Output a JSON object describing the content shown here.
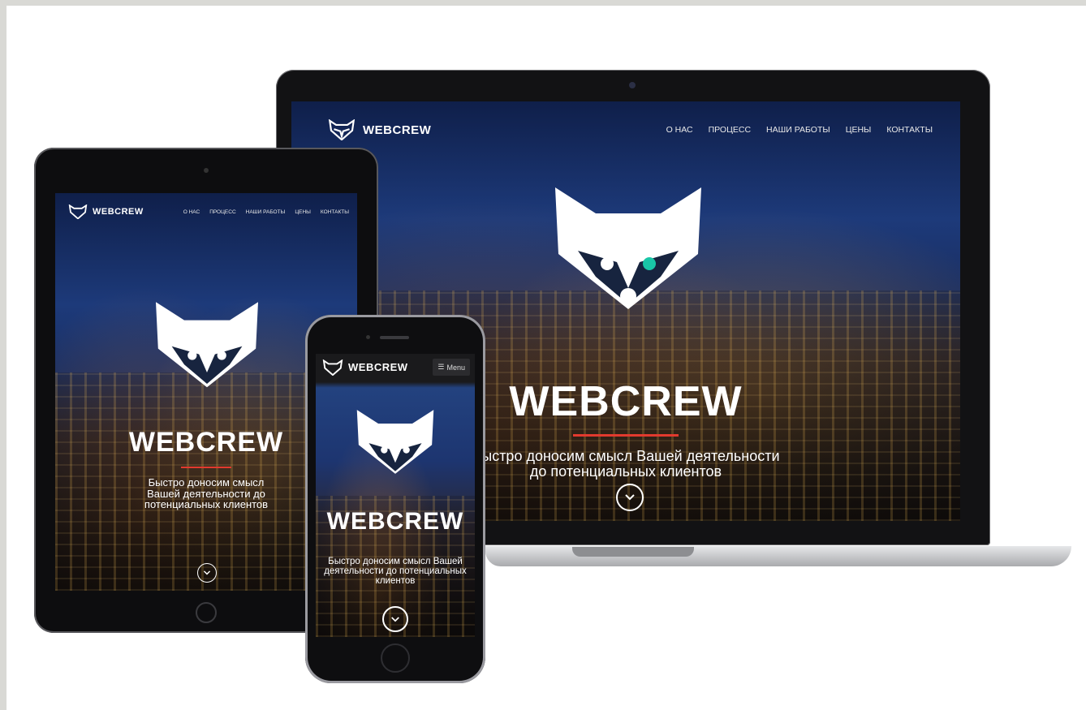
{
  "brand": {
    "name": "WEBCREW"
  },
  "nav": {
    "items": [
      "О НАС",
      "ПРОЦЕСС",
      "НАШИ РАБОТЫ",
      "ЦЕНЫ",
      "КОНТАКТЫ"
    ]
  },
  "hero": {
    "title": "WEBCREW",
    "tagline_desktop_1": "Быстро доносим смысл Вашей деятельности",
    "tagline_desktop_2": "до потенциальных клиентов",
    "tagline_tablet_1": "Быстро доносим смысл",
    "tagline_tablet_2": "Вашей деятельности до",
    "tagline_tablet_3": "потенциальных клиентов",
    "tagline_phone_1": "Быстро доносим смысл Вашей",
    "tagline_phone_2": "деятельности до потенциальных",
    "tagline_phone_3": "клиентов"
  },
  "phone": {
    "menu_label": "Menu"
  },
  "icons": [
    "raccoon-logo-icon",
    "chevron-down-icon",
    "hamburger-icon"
  ],
  "colors": {
    "accent": "#e23a2e",
    "device_frame": "#1b1b1d",
    "aluminum": "#c9cacc"
  }
}
